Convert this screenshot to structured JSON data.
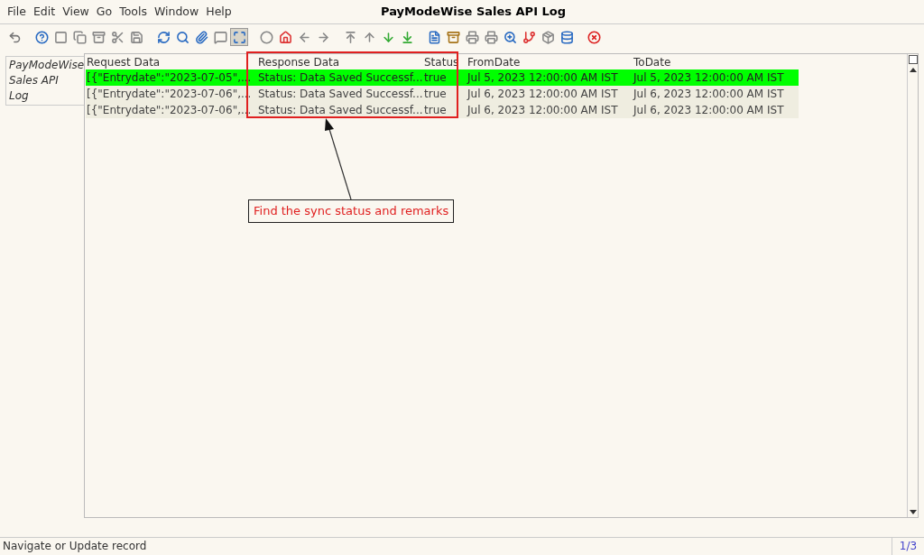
{
  "menu": [
    "File",
    "Edit",
    "View",
    "Go",
    "Tools",
    "Window",
    "Help"
  ],
  "window": {
    "title": "PayModeWise Sales API Log"
  },
  "toolbar": [
    {
      "kind": "undo",
      "pressed": false
    },
    {
      "kind": "help",
      "pressed": false
    },
    {
      "kind": "new",
      "pressed": false
    },
    {
      "kind": "copy",
      "pressed": false
    },
    {
      "kind": "delete",
      "pressed": false
    },
    {
      "kind": "delete-selection",
      "pressed": false
    },
    {
      "kind": "save",
      "pressed": false
    },
    {
      "kind": "refresh",
      "pressed": false
    },
    {
      "kind": "find",
      "pressed": false
    },
    {
      "kind": "attachment",
      "pressed": false
    },
    {
      "kind": "chat",
      "pressed": false
    },
    {
      "kind": "grid-toggle",
      "pressed": true
    },
    {
      "kind": "history",
      "pressed": false
    },
    {
      "kind": "home",
      "pressed": false
    },
    {
      "kind": "back",
      "pressed": false
    },
    {
      "kind": "forward",
      "pressed": false
    },
    {
      "kind": "first",
      "pressed": false
    },
    {
      "kind": "previous",
      "pressed": false
    },
    {
      "kind": "next",
      "pressed": false
    },
    {
      "kind": "last",
      "pressed": false
    },
    {
      "kind": "report",
      "pressed": false
    },
    {
      "kind": "archive",
      "pressed": false
    },
    {
      "kind": "print",
      "pressed": false
    },
    {
      "kind": "print",
      "pressed": false
    },
    {
      "kind": "zoom-across",
      "pressed": false
    },
    {
      "kind": "workflow",
      "pressed": false
    },
    {
      "kind": "product",
      "pressed": false
    },
    {
      "kind": "request",
      "pressed": false
    },
    {
      "kind": "close",
      "pressed": false
    }
  ],
  "side_tab": {
    "label": "PayModeWise Sales API Log",
    "selected": true
  },
  "table": {
    "columns": [
      "Request Data",
      "Response Data",
      "Status",
      "FromDate",
      "ToDate"
    ],
    "rows": [
      {
        "selected": true,
        "cells": [
          "[{\"Entrydate\":\"2023-07-05\",...",
          "Status: Data Saved Successf...",
          "true",
          "Jul 5, 2023 12:00:00 AM IST",
          "Jul 5, 2023 12:00:00 AM IST"
        ]
      },
      {
        "selected": false,
        "cells": [
          "[{\"Entrydate\":\"2023-07-06\",...",
          "Status: Data Saved Successf...",
          "true",
          "Jul 6, 2023 12:00:00 AM IST",
          "Jul 6, 2023 12:00:00 AM IST"
        ]
      },
      {
        "selected": false,
        "cells": [
          "[{\"Entrydate\":\"2023-07-06\",...",
          "Status: Data Saved Successf...",
          "true",
          "Jul 6, 2023 12:00:00 AM IST",
          "Jul 6, 2023 12:00:00 AM IST"
        ]
      }
    ]
  },
  "annotation": {
    "text": "Find the sync status and remarks"
  },
  "status_bar": {
    "message": "Navigate or Update record",
    "record": "1/3"
  }
}
